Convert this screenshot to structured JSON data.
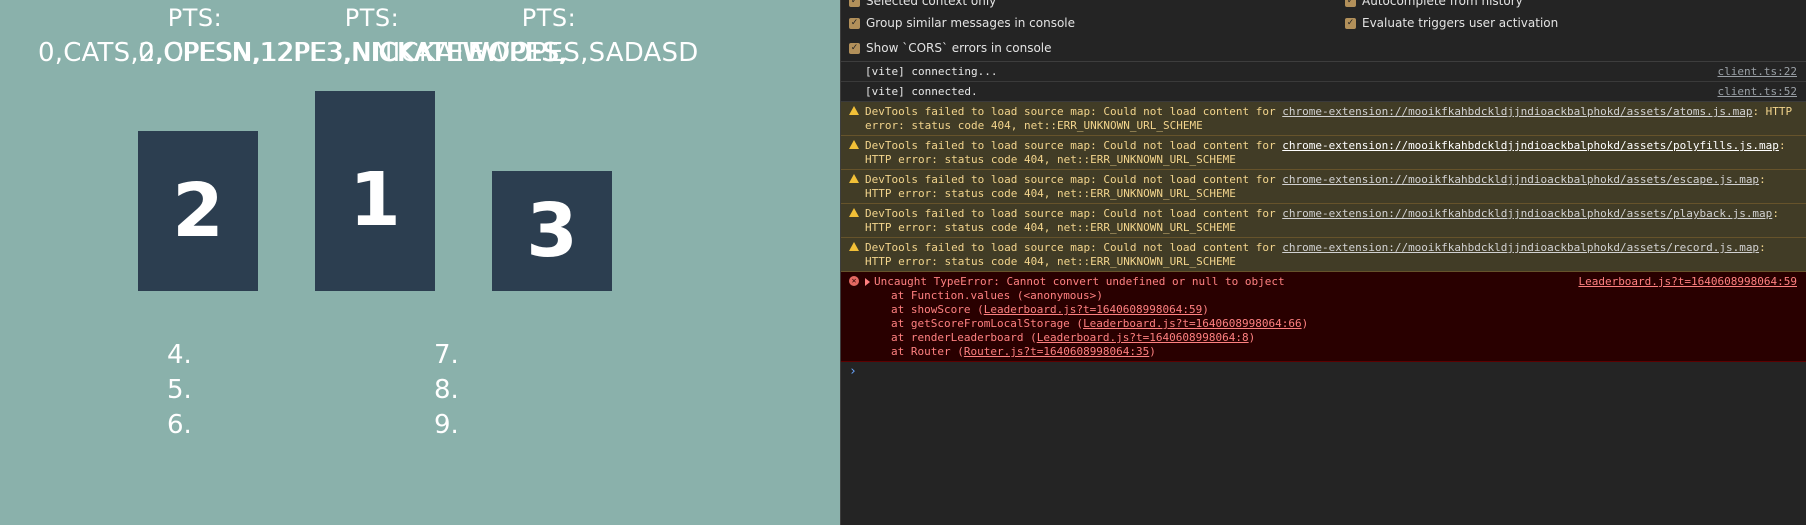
{
  "app": {
    "pts": [
      "PTS:",
      "PTS:",
      "PTS:"
    ],
    "names": [
      "0,CATS,2,CPESN,12PE3,NICKATEWOPES,",
      "0,OPESN,12PE3,NICKATEWOPES,",
      "NICKATEWOPES,SADASD"
    ],
    "podium": [
      "2",
      "1",
      "3"
    ],
    "ranks_left": [
      "4.",
      "5.",
      "6."
    ],
    "ranks_right": [
      "7.",
      "8.",
      "9."
    ]
  },
  "devtools": {
    "settings": [
      {
        "label": "Selected context only",
        "checked": true
      },
      {
        "label": "Group similar messages in console",
        "checked": true
      },
      {
        "label": "Show `CORS` errors in console",
        "checked": true
      },
      {
        "label": "Autocomplete from history",
        "checked": true
      },
      {
        "label": "Evaluate triggers user activation",
        "checked": true
      }
    ],
    "logs": [
      {
        "text": "[vite] connecting...",
        "source": "client.ts:22"
      },
      {
        "text": "[vite] connected.",
        "source": "client.ts:52"
      }
    ],
    "warnings": [
      {
        "prefix": "DevTools failed to load source map: Could not load content for ",
        "url": "chrome-extension://mooikfkahbdckldjjndioackbalphokd/assets/atoms.js.map",
        "suffix": ": HTTP error: status code 404, net::ERR_UNKNOWN_URL_SCHEME"
      },
      {
        "prefix": "DevTools failed to load source map: Could not load content for ",
        "url": "chrome-extension://mooikfkahbdckldjjndioackbalphokd/assets/polyfills.js.map",
        "suffix": ": HTTP error: status code 404, net::ERR_UNKNOWN_URL_SCHEME"
      },
      {
        "prefix": "DevTools failed to load source map: Could not load content for ",
        "url": "chrome-extension://mooikfkahbdckldjjndioackbalphokd/assets/escape.js.map",
        "suffix": ": HTTP error: status code 404, net::ERR_UNKNOWN_URL_SCHEME"
      },
      {
        "prefix": "DevTools failed to load source map: Could not load content for ",
        "url": "chrome-extension://mooikfkahbdckldjjndioackbalphokd/assets/playback.js.map",
        "suffix": ": HTTP error: status code 404, net::ERR_UNKNOWN_URL_SCHEME"
      },
      {
        "prefix": "DevTools failed to load source map: Could not load content for ",
        "url": "chrome-extension://mooikfkahbdckldjjndioackbalphokd/assets/record.js.map",
        "suffix": ": HTTP error: status code 404, net::ERR_UNKNOWN_URL_SCHEME"
      }
    ],
    "error": {
      "message": "Uncaught TypeError: Cannot convert undefined or null to object",
      "source": "Leaderboard.js?t=1640608998064:59",
      "stack": [
        {
          "prefix": "at Function.values (",
          "link": "<anonymous>",
          "suffix": ")"
        },
        {
          "prefix": "at showScore (",
          "link": "Leaderboard.js?t=1640608998064:59",
          "suffix": ")"
        },
        {
          "prefix": "at getScoreFromLocalStorage (",
          "link": "Leaderboard.js?t=1640608998064:66",
          "suffix": ")"
        },
        {
          "prefix": "at renderLeaderboard (",
          "link": "Leaderboard.js?t=1640608998064:8",
          "suffix": ")"
        },
        {
          "prefix": "at Router (",
          "link": "Router.js?t=1640608998064:35",
          "suffix": ")"
        }
      ]
    },
    "prompt_symbol": "›"
  }
}
